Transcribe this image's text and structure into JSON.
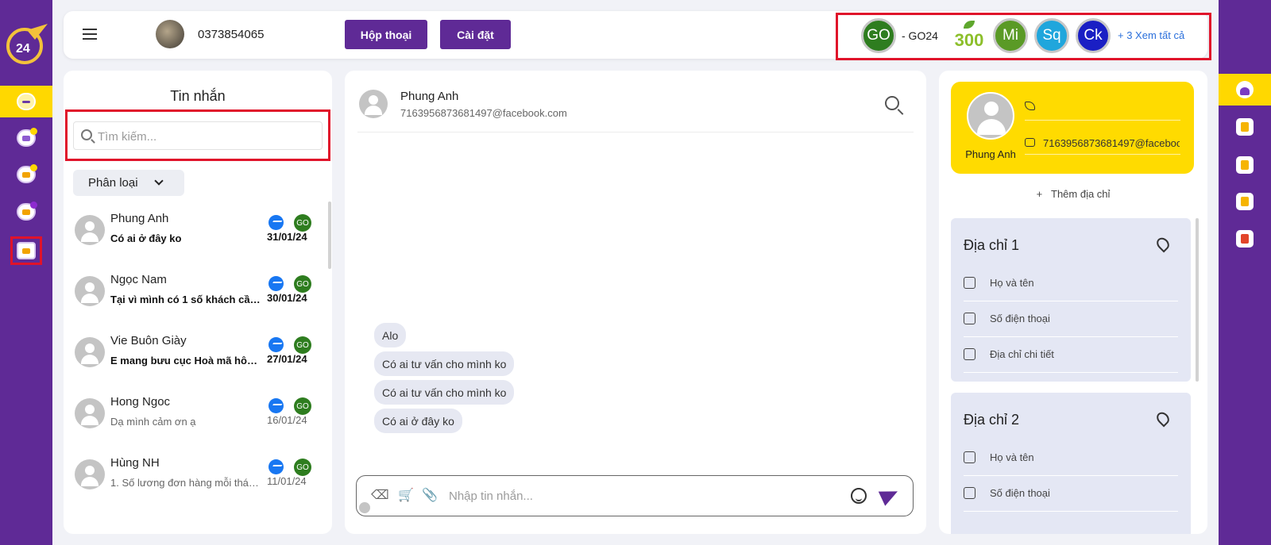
{
  "colors": {
    "brand": "#5f2a96",
    "accent": "#ffd800",
    "messenger": "#1877f2",
    "page_go": "#2e7d1f"
  },
  "topbar": {
    "phone": "0373854065",
    "btn_conversations": "Hộp thoại",
    "btn_settings": "Cài đặt",
    "pages": [
      {
        "abbr": "GO",
        "label": "- GO24",
        "color": "#2e7d1f"
      },
      {
        "abbr": "300",
        "color": "#8cbf2a"
      },
      {
        "abbr": "Mi",
        "color": "#5a9a26"
      },
      {
        "abbr": "Sq",
        "color": "#20a6dc"
      },
      {
        "abbr": "Ck",
        "color": "#1a1fc4"
      }
    ],
    "see_all": "+ 3 Xem tất cả"
  },
  "list": {
    "title": "Tin nhắn",
    "search_placeholder": "Tìm kiếm...",
    "filter_label": "Phân loại",
    "conversations": [
      {
        "name": "Phung Anh",
        "preview": "Có ai ở đây ko",
        "date": "31/01/24",
        "unread": true,
        "page": "GO"
      },
      {
        "name": "Ngọc Nam",
        "preview": "Tại vì mình có 1 số khách cần...",
        "date": "30/01/24",
        "unread": true,
        "page": "GO"
      },
      {
        "name": "Vie Buôn Giày",
        "preview": "E mang bưu cục Hoà mã hôm...",
        "date": "27/01/24",
        "unread": true,
        "page": "GO"
      },
      {
        "name": "Hong Ngoc",
        "preview": "Dạ mình cảm ơn ạ",
        "date": "16/01/24",
        "unread": false,
        "page": "GO"
      },
      {
        "name": "Hùng NH",
        "preview": "1. Số lương đơn hàng mỗi thán...",
        "date": "11/01/24",
        "unread": false,
        "page": "GO"
      }
    ]
  },
  "chat": {
    "name": "Phung Anh",
    "email": "7163956873681497@facebook.com",
    "messages": [
      "Alo",
      "Có ai tư vấn cho mình ko",
      "Có ai tư vấn cho mình ko",
      "Có ai ở đây ko"
    ],
    "input_placeholder": "Nhập tin nhắn..."
  },
  "info": {
    "name": "Phung Anh",
    "phone": "",
    "email": "7163956873681497@facebook.com",
    "add_address": "Thêm địa chỉ",
    "addresses": [
      {
        "title": "Địa chỉ 1",
        "fields": [
          "Họ và tên",
          "Số điện thoại",
          "Địa chỉ chi tiết"
        ]
      },
      {
        "title": "Địa chỉ 2",
        "fields": [
          "Họ và tên",
          "Số điện thoại"
        ]
      }
    ]
  }
}
